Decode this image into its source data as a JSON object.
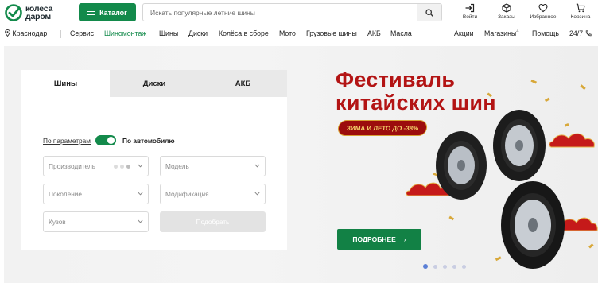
{
  "logo": {
    "line1": "колеса",
    "line2": "даром"
  },
  "catalog": {
    "label": "Каталог"
  },
  "search": {
    "placeholder": "Искать популярные летние шины"
  },
  "header_actions": [
    {
      "label": "Войти",
      "icon": "login-icon"
    },
    {
      "label": "Заказы",
      "icon": "box-icon"
    },
    {
      "label": "Избранное",
      "icon": "heart-icon"
    },
    {
      "label": "Корзина",
      "icon": "cart-icon"
    }
  ],
  "nav": {
    "city": "Краснодар",
    "items": [
      "Сервис",
      "Шиномонтаж",
      "Шины",
      "Диски",
      "Колёса в сборе",
      "Мото",
      "Грузовые шины",
      "АКБ",
      "Масла"
    ],
    "active_item": "Шиномонтаж",
    "right": [
      "Акции",
      "Магазины",
      "Помощь",
      "24/7"
    ],
    "stores_count": "4"
  },
  "panel": {
    "tabs": [
      "Шины",
      "Диски",
      "АКБ"
    ],
    "active_tab": "Шины",
    "mode_params": "По параметрам",
    "mode_car": "По автомобилю",
    "fields": {
      "manufacturer": "Производитель",
      "model": "Модель",
      "generation": "Поколение",
      "modification": "Модификация",
      "body": "Кузов"
    },
    "submit": "Подобрать"
  },
  "promo": {
    "title_line1": "Фестиваль",
    "title_line2": "китайских шин",
    "badge": "ЗИМА И ЛЕТО ДО -38%",
    "button": "ПОДРОБНЕЕ",
    "button_arrow": "›",
    "slides_total": 5,
    "active_slide": 1
  },
  "colors": {
    "brand_green": "#138a4b",
    "promo_red": "#b31414",
    "badge_red": "#9c0d0d",
    "badge_gold": "#f4d06a"
  }
}
